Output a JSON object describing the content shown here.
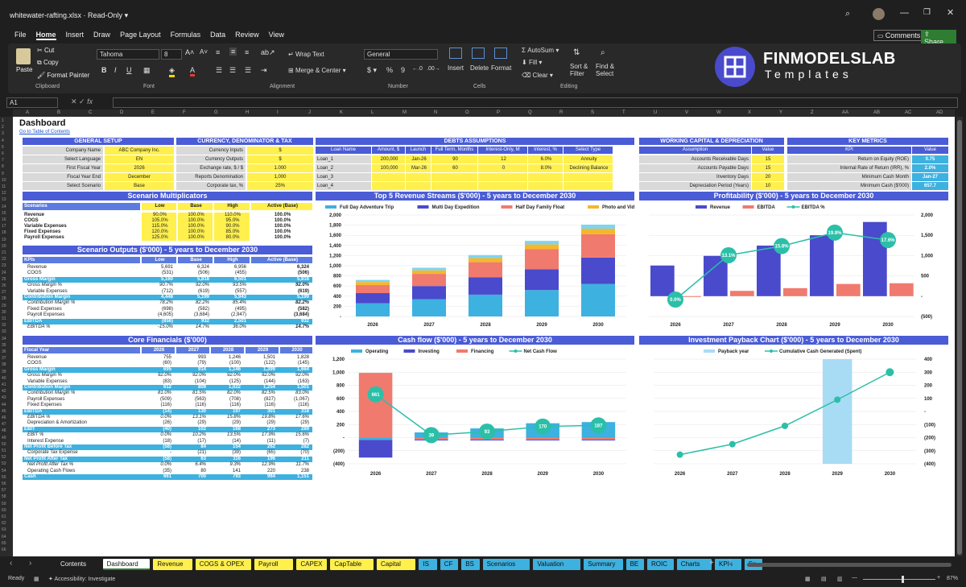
{
  "titlebar": {
    "filename": "whitewater-rafting.xlsx",
    "mode": "Read-Only"
  },
  "menu": [
    "File",
    "Home",
    "Insert",
    "Draw",
    "Page Layout",
    "Formulas",
    "Data",
    "Review",
    "View"
  ],
  "comments_label": "Comments",
  "share_label": "Share",
  "ribbon": {
    "paste": "Paste",
    "cut": "Cut",
    "copy": "Copy",
    "format_painter": "Format Painter",
    "clipboard": "Clipboard",
    "font_name": "Tahoma",
    "font_size": "8",
    "font": "Font",
    "wrap_text": "Wrap Text",
    "merge_center": "Merge & Center",
    "alignment": "Alignment",
    "number_format": "General",
    "number": "Number",
    "insert": "Insert",
    "delete": "Delete",
    "format": "Format",
    "cells": "Cells",
    "autosum": "AutoSum",
    "fill": "Fill",
    "clear": "Clear",
    "sort_filter": "Sort & Filter",
    "find_select": "Find & Select",
    "editing": "Editing"
  },
  "brand": {
    "name": "FINMODELSLAB",
    "tagline": "Templates"
  },
  "namebox": "A1",
  "columns": [
    "A",
    "B",
    "C",
    "D",
    "E",
    "F",
    "G",
    "H",
    "I",
    "J",
    "K",
    "L",
    "M",
    "N",
    "O",
    "P",
    "Q",
    "R",
    "S",
    "T",
    "U",
    "V",
    "W",
    "X",
    "Y",
    "Z",
    "AA",
    "AB",
    "AC",
    "AD"
  ],
  "sheet": {
    "title": "Dashboard",
    "toc_link": "Go to Table of Contents"
  },
  "general_setup": {
    "title": "GENERAL SETUP",
    "rows": [
      [
        "Company Name",
        "ABC Company Inc."
      ],
      [
        "Select Language",
        "EN"
      ],
      [
        "First Fiscal Year",
        "2026"
      ],
      [
        "Fiscal Year End",
        "December"
      ],
      [
        "Select Scenario",
        "Base"
      ]
    ]
  },
  "currency": {
    "title": "CURRENCY, DENOMINATOR & TAX",
    "rows": [
      [
        "Currency Inputs",
        "$"
      ],
      [
        "Currency Outputs",
        "$"
      ],
      [
        "Exchange rate, $ / $",
        "1.000"
      ],
      [
        "Reports Denomination",
        "1,000"
      ],
      [
        "Corporate tax, %",
        "25%"
      ]
    ]
  },
  "debts": {
    "title": "DEBTS ASSUMPTIONS",
    "headers": [
      "Loan Name",
      "Amount, $",
      "Launch",
      "Full Term, Months",
      "Interest-Only, M",
      "Interest, %",
      "Select Type"
    ],
    "rows": [
      [
        "Loan_1",
        "200,000",
        "Jan-26",
        "90",
        "12",
        "6.0%",
        "Annuity"
      ],
      [
        "Loan_2",
        "100,000",
        "Mar-26",
        "60",
        "0",
        "8.0%",
        "Declining Balance"
      ],
      [
        "Loan_3",
        "",
        "",
        "",
        "",
        "",
        ""
      ],
      [
        "Loan_4",
        "",
        "",
        "",
        "",
        "",
        ""
      ]
    ]
  },
  "working_capital": {
    "title": "WORKING CAPITAL & DEPRECIATION",
    "headers": [
      "Assumption",
      "Value"
    ],
    "rows": [
      [
        "Accounts Receivable Days",
        "15"
      ],
      [
        "Accounts Payable Days",
        "15"
      ],
      [
        "Inventory Days",
        "20"
      ],
      [
        "Depreciation Period (Years)",
        "10"
      ]
    ]
  },
  "key_metrics": {
    "title": "KEY METRICS",
    "headers": [
      "KPI",
      "Value"
    ],
    "rows": [
      [
        "Return on Equity (ROE)",
        "0.75"
      ],
      [
        "Internal Rate of Return (IRR), %",
        "2.0%"
      ],
      [
        "Minimum Cash Month",
        "Jan-27"
      ],
      [
        "Minimum Cash ($'000)",
        "657.7"
      ]
    ]
  },
  "scenario_mult": {
    "title": "Scenario Multiplicators",
    "headers": [
      "Scenarios",
      "Low",
      "Base",
      "High",
      "Active (Base)"
    ],
    "rows": [
      [
        "Revenue",
        "90.0%",
        "100.0%",
        "110.0%",
        "100.0%"
      ],
      [
        "COGS",
        "105.0%",
        "100.0%",
        "95.0%",
        "100.0%"
      ],
      [
        "Variable Expenses",
        "115.0%",
        "100.0%",
        "90.0%",
        "100.0%"
      ],
      [
        "Fixed Expenses",
        "120.0%",
        "100.0%",
        "85.0%",
        "100.0%"
      ],
      [
        "Payroll Expenses",
        "125.0%",
        "100.0%",
        "80.0%",
        "100.0%"
      ]
    ]
  },
  "scenario_out": {
    "title": "Scenario Outputs ($'000) - 5 years to December 2030",
    "headers": [
      "KPIs",
      "Low",
      "Base",
      "High",
      "Active (Base)"
    ],
    "rows": [
      {
        "k": "Revenue",
        "v": [
          "5,691",
          "6,324",
          "6,956",
          "6,324"
        ],
        "s": ""
      },
      {
        "k": "COGS",
        "v": [
          "(531)",
          "(506)",
          "(455)",
          "(506)"
        ],
        "s": ""
      },
      {
        "k": "Gross Margin",
        "v": [
          "5,160",
          "5,818",
          "6,501",
          "5,818"
        ],
        "s": "hl"
      },
      {
        "k": "Gross Margin %",
        "v": [
          "90.7%",
          "92.0%",
          "93.5%",
          "92.0%"
        ],
        "s": "it"
      },
      {
        "k": "Variable Expenses",
        "v": [
          "(712)",
          "(619)",
          "(557)",
          "(619)"
        ],
        "s": ""
      },
      {
        "k": "Contribution Margin",
        "v": [
          "4,448",
          "5,199",
          "5,943",
          "5,199"
        ],
        "s": "hl"
      },
      {
        "k": "Contribution Margin %",
        "v": [
          "78.2%",
          "82.2%",
          "85.4%",
          "82.2%"
        ],
        "s": "it"
      },
      {
        "k": "Fixed Expenses",
        "v": [
          "(698)",
          "(582)",
          "(495)",
          "(582)"
        ],
        "s": ""
      },
      {
        "k": "Payroll Expenses",
        "v": [
          "(4,605)",
          "(3,684)",
          "(2,947)",
          "(3,684)"
        ],
        "s": ""
      },
      {
        "k": "EBITDA",
        "v": [
          "(856)",
          "932",
          "2,501",
          "932"
        ],
        "s": "hl"
      },
      {
        "k": "EBITDA %",
        "v": [
          "-15.0%",
          "14.7%",
          "36.0%",
          "14.7%"
        ],
        "s": "it"
      }
    ]
  },
  "core": {
    "title": "Core Financials ($'000)",
    "headers": [
      "Fiscal Year",
      "2026",
      "2027",
      "2028",
      "2029",
      "2030"
    ],
    "rows": [
      {
        "k": "Revenue",
        "v": [
          "755",
          "993",
          "1,246",
          "1,501",
          "1,828"
        ],
        "s": ""
      },
      {
        "k": "COGS",
        "v": [
          "(60)",
          "(79)",
          "(100)",
          "(122)",
          "(145)"
        ],
        "s": ""
      },
      {
        "k": "Gross Margin",
        "v": [
          "695",
          "914",
          "1,146",
          "1,399",
          "1,664"
        ],
        "s": "hl"
      },
      {
        "k": "Gross Margin %",
        "v": [
          "92.0%",
          "92.0%",
          "92.0%",
          "92.0%",
          "92.0%"
        ],
        "s": "it"
      },
      {
        "k": "Variable Expenses",
        "v": [
          "(83)",
          "(104)",
          "(125)",
          "(144)",
          "(163)"
        ],
        "s": ""
      },
      {
        "k": "Contribution Margin",
        "v": [
          "612",
          "809",
          "1,022",
          "1,254",
          "1,501"
        ],
        "s": "hl"
      },
      {
        "k": "Contribution Margin %",
        "v": [
          "81.0%",
          "81.5%",
          "82.0%",
          "82.5%",
          "83.0%"
        ],
        "s": "it"
      },
      {
        "k": "Payroll Expenses",
        "v": [
          "(509)",
          "(563)",
          "(708)",
          "(827)",
          "(1,067)"
        ],
        "s": ""
      },
      {
        "k": "Fixed Expenses",
        "v": [
          "(116)",
          "(116)",
          "(116)",
          "(116)",
          "(116)"
        ],
        "s": ""
      },
      {
        "k": "EBITDA",
        "v": [
          "(14)",
          "130",
          "197",
          "301",
          "318"
        ],
        "s": "hl"
      },
      {
        "k": "EBITDA %",
        "v": [
          "0.0%",
          "13.1%",
          "15.8%",
          "19.8%",
          "17.6%"
        ],
        "s": "it"
      },
      {
        "k": "Depreciation & Amortization",
        "v": [
          "(26)",
          "(29)",
          "(29)",
          "(29)",
          "(29)"
        ],
        "s": ""
      },
      {
        "k": "EBIT",
        "v": [
          "(40)",
          "102",
          "168",
          "273",
          "289"
        ],
        "s": "hl"
      },
      {
        "k": "EBIT %",
        "v": [
          "0.0%",
          "10.2%",
          "13.5%",
          "17.9%",
          "15.6%"
        ],
        "s": "it"
      },
      {
        "k": "Interest Expense",
        "v": [
          "(18)",
          "(17)",
          "(14)",
          "(11)",
          "(7)"
        ],
        "s": ""
      },
      {
        "k": "Net Profit Before Tax",
        "v": [
          "(58)",
          "84",
          "154",
          "262",
          "282"
        ],
        "s": "hl"
      },
      {
        "k": "Corporate Tax Expense",
        "v": [
          "-",
          "(21)",
          "(39)",
          "(65)",
          "(70)"
        ],
        "s": ""
      },
      {
        "k": "Net Profit After Tax",
        "v": [
          "(58)",
          "63",
          "116",
          "196",
          "211"
        ],
        "s": "hl"
      },
      {
        "k": "Net Profit After Tax %",
        "v": [
          "0.0%",
          "6.4%",
          "9.3%",
          "12.9%",
          "11.7%"
        ],
        "s": "it"
      },
      {
        "k": "Operating Cash Flows",
        "v": [
          "(35)",
          "80",
          "141",
          "220",
          "238"
        ],
        "s": ""
      },
      {
        "k": "Cash",
        "v": [
          "661",
          "700",
          "793",
          "964",
          "1,151"
        ],
        "s": "hl"
      }
    ]
  },
  "chart_data": [
    {
      "type": "bar",
      "title": "Top 5 Revenue Streams ($'000) - 5 years to December 2030",
      "categories": [
        "2026",
        "2027",
        "2028",
        "2029",
        "2030"
      ],
      "series": [
        {
          "name": "Full Day Adventure Trip",
          "values": [
            260,
            340,
            430,
            520,
            640
          ]
        },
        {
          "name": "Multi Day Expedition",
          "values": [
            200,
            260,
            340,
            410,
            520
          ]
        },
        {
          "name": "Half Day Family Float",
          "values": [
            160,
            240,
            300,
            400,
            460
          ]
        },
        {
          "name": "Photo and Video Packages",
          "values": [
            60,
            70,
            80,
            90,
            110
          ]
        },
        {
          "name": "Other Revenue",
          "values": [
            40,
            50,
            60,
            70,
            80
          ]
        }
      ],
      "ylim": [
        0,
        2000
      ],
      "yticks": [
        "-",
        "200",
        "400",
        "600",
        "800",
        "1,000",
        "1,200",
        "1,400",
        "1,600",
        "1,800",
        "2,000"
      ],
      "colors": [
        "#3db1e0",
        "#4a4acc",
        "#f07a6e",
        "#f5b82a",
        "#7fd4f0"
      ]
    },
    {
      "type": "bar",
      "title": "Profitability ($'000) - 5 years to December 2030",
      "categories": [
        "2026",
        "2027",
        "2028",
        "2029",
        "2030"
      ],
      "series": [
        {
          "name": "Revenue",
          "values": [
            755,
            993,
            1246,
            1501,
            1828
          ]
        },
        {
          "name": "EBITDA",
          "values": [
            -14,
            130,
            197,
            301,
            318
          ]
        },
        {
          "name": "EBITDA %",
          "values": [
            0.0,
            13.1,
            15.8,
            19.8,
            17.6
          ]
        }
      ],
      "point_labels": [
        "0.0%",
        "13.1%",
        "15.8%",
        "19.8%",
        "17.6%"
      ],
      "ylim": [
        -500,
        2000
      ],
      "yticks": [
        "(500)",
        "-",
        "500",
        "1,000",
        "1,500",
        "2,000"
      ],
      "colors": [
        "#4a4acc",
        "#f07a6e",
        "#2bbfa8"
      ]
    },
    {
      "type": "bar",
      "title": "Cash flow ($'000) - 5 years to December 2030",
      "categories": [
        "2026",
        "2027",
        "2028",
        "2029",
        "2030"
      ],
      "series": [
        {
          "name": "Operating",
          "values": [
            -35,
            80,
            141,
            220,
            238
          ]
        },
        {
          "name": "Investing",
          "values": [
            -270,
            -10,
            -10,
            -10,
            -10
          ]
        },
        {
          "name": "Financing",
          "values": [
            990,
            -30,
            -30,
            -30,
            -30
          ]
        },
        {
          "name": "Net Cash Flow",
          "values": [
            661,
            39,
            93,
            170,
            187
          ]
        }
      ],
      "point_labels": [
        "661",
        "39",
        "93",
        "170",
        "187"
      ],
      "ylim": [
        -400,
        1200
      ],
      "yticks": [
        "(400)",
        "(200)",
        "-",
        "200",
        "400",
        "600",
        "800",
        "1,000",
        "1,200"
      ],
      "colors": [
        "#3db1e0",
        "#4a4acc",
        "#f07a6e",
        "#2bbfa8"
      ]
    },
    {
      "type": "line",
      "title": "Investment Payback Chart ($'000) - 5 years to December 2030",
      "categories": [
        "2026",
        "2027",
        "2028",
        "2029",
        "2030"
      ],
      "series": [
        {
          "name": "Payback year",
          "values": [
            0,
            0,
            0,
            1,
            0
          ]
        },
        {
          "name": "Cumulative Cash Generated (Spent)",
          "values": [
            -330,
            -250,
            -110,
            90,
            300
          ]
        }
      ],
      "ylim": [
        -400,
        400
      ],
      "yticks": [
        "(400)",
        "(300)",
        "(200)",
        "(100)",
        "-",
        "100",
        "200",
        "300",
        "400"
      ],
      "colors": [
        "#a8dcf5",
        "#2bbfa8"
      ]
    }
  ],
  "sheet_tabs": [
    {
      "l": "Contents",
      "c": "none"
    },
    {
      "l": "Dashboard",
      "c": "active"
    },
    {
      "l": "Revenue",
      "c": "#fff04d"
    },
    {
      "l": "COGS & OPEX",
      "c": "#fff04d"
    },
    {
      "l": "Payroll",
      "c": "#fff04d"
    },
    {
      "l": "CAPEX",
      "c": "#fff04d"
    },
    {
      "l": "CapTable",
      "c": "#fff04d"
    },
    {
      "l": "Capital",
      "c": "#fff04d"
    },
    {
      "l": "IS",
      "c": "#3db1e0"
    },
    {
      "l": "CF",
      "c": "#3db1e0"
    },
    {
      "l": "BS",
      "c": "#3db1e0"
    },
    {
      "l": "Scenarios",
      "c": "#3db1e0"
    },
    {
      "l": "Valuation",
      "c": "#3db1e0"
    },
    {
      "l": "Summary",
      "c": "#3db1e0"
    },
    {
      "l": "BE",
      "c": "#3db1e0"
    },
    {
      "l": "ROIC",
      "c": "#3db1e0"
    },
    {
      "l": "Charts",
      "c": "#3db1e0"
    },
    {
      "l": "KPIs",
      "c": "#3db1e0"
    },
    {
      "l": "Se",
      "c": "#3db1e0"
    }
  ],
  "status": {
    "ready": "Ready",
    "accessibility": "Accessibility: Investigate",
    "zoom": "87%"
  }
}
